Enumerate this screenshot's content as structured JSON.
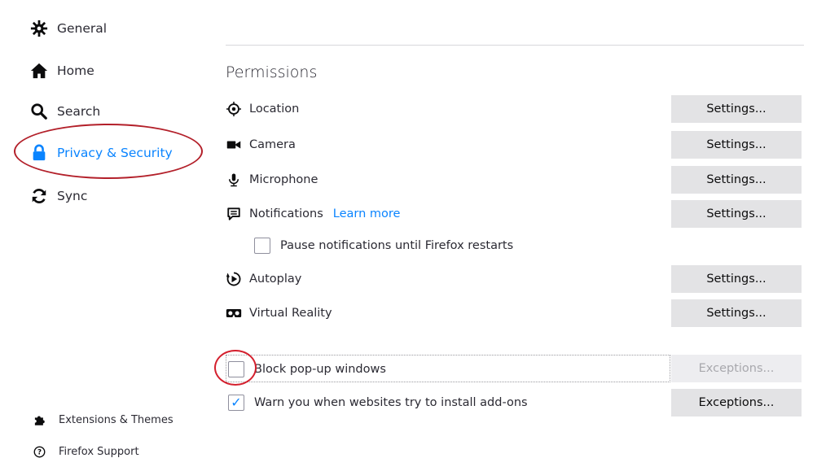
{
  "sidebar": {
    "items": [
      {
        "label": "General",
        "icon": "gear-icon"
      },
      {
        "label": "Home",
        "icon": "home-icon"
      },
      {
        "label": "Search",
        "icon": "search-icon"
      },
      {
        "label": "Privacy & Security",
        "icon": "lock-icon",
        "selected": true
      },
      {
        "label": "Sync",
        "icon": "sync-icon"
      }
    ],
    "footer": [
      {
        "label": "Extensions & Themes",
        "icon": "puzzle-icon"
      },
      {
        "label": "Firefox Support",
        "icon": "help-icon"
      }
    ]
  },
  "permissions": {
    "title": "Permissions",
    "rows": [
      {
        "label": "Location",
        "button": "Settings..."
      },
      {
        "label": "Camera",
        "button": "Settings..."
      },
      {
        "label": "Microphone",
        "button": "Settings..."
      },
      {
        "label": "Notifications",
        "link": "Learn more",
        "button": "Settings..."
      },
      {
        "label": "Autoplay",
        "button": "Settings..."
      },
      {
        "label": "Virtual Reality",
        "button": "Settings..."
      }
    ],
    "pause_notifications": {
      "label": "Pause notifications until Firefox restarts",
      "checked": false
    },
    "block_popups": {
      "label": "Block pop-up windows",
      "checked": false,
      "button": "Exceptions..."
    },
    "warn_addons": {
      "label": "Warn you when websites try to install add-ons",
      "checked": true,
      "button": "Exceptions..."
    }
  },
  "colors": {
    "accent": "#0a84ff",
    "annotation": "#b3202a"
  }
}
